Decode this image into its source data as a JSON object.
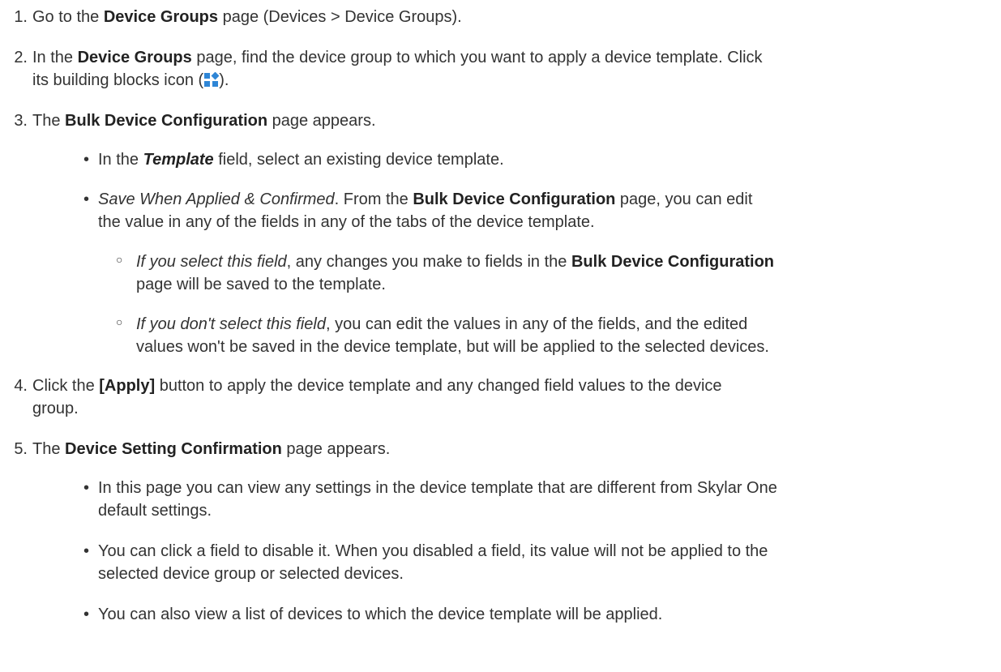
{
  "steps": [
    {
      "num": "1.",
      "t1": "Go to the ",
      "b1": "Device Groups",
      "t2": " page (Devices > Device Groups)."
    },
    {
      "num": "2.",
      "t1": "In the ",
      "b1": "Device Groups",
      "t2": " page, find the device group to which you want to apply a device template. Click",
      "line2_pre": "its building blocks icon (",
      "line2_post": ")."
    },
    {
      "num": "3.",
      "t1": "The ",
      "b1": "Bulk Device Configuration",
      "t2": " page appears.",
      "bullets": [
        {
          "t1": "In the ",
          "bi1": "Template",
          "t2": " field, select an existing device template."
        },
        {
          "i1": "Save When Applied & Confirmed",
          "t1": ". From the ",
          "b1": "Bulk Device Configuration",
          "t2": " page, you can edit",
          "line2": "the value in any of the fields in any of the tabs of the device template.",
          "subs": [
            {
              "i1": "If you select this field",
              "t1": ", any changes you make to fields in the ",
              "b1": "Bulk Device Configuration",
              "line2": "page will be saved to the template."
            },
            {
              "i1": "If you don't select this field",
              "t1": ", you can edit the values in any of the fields, and the edited",
              "line2": "values won't be saved in the device template, but will be applied to the selected devices."
            }
          ]
        }
      ]
    },
    {
      "num": "4.",
      "t1": "Click the ",
      "b1": "[Apply]",
      "t2": " button to apply the device template and any changed field values to the device",
      "line2": "group."
    },
    {
      "num": "5.",
      "t1": "The ",
      "b1": "Device Setting Confirmation",
      "t2": " page appears.",
      "bullets": [
        {
          "t1": "In this page you can view any settings in the device template that are different from Skylar One",
          "line2": "default settings."
        },
        {
          "t1": "You can click a field to disable it. When you disabled a field, its value will not be applied to the",
          "line2": "selected device group or selected devices."
        },
        {
          "t1": "You can also view a list of devices to which the device template will be applied."
        }
      ]
    }
  ],
  "icon": {
    "name": "building-blocks-icon",
    "color": "#2f86d6"
  }
}
